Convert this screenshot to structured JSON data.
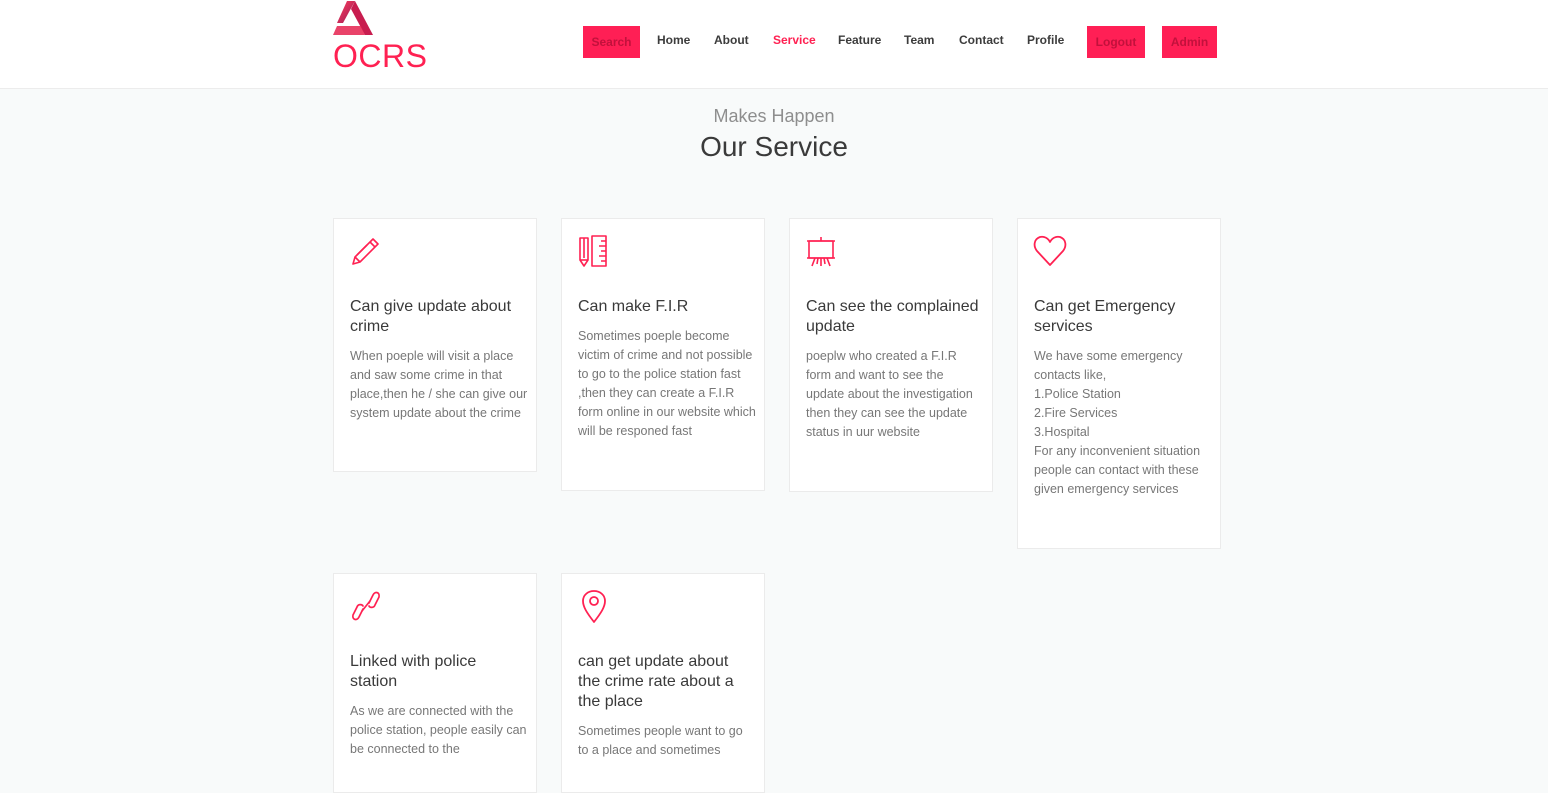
{
  "brand": {
    "name": "OCRS",
    "logo_icon": "triangle-logo-icon"
  },
  "nav": {
    "search_label": "Search",
    "links": [
      "Home",
      "About",
      "Service",
      "Feature",
      "Team",
      "Contact",
      "Profile"
    ],
    "active": "Service",
    "logout_label": "Logout",
    "admin_label": "Admin"
  },
  "section": {
    "subtitle": "Makes Happen",
    "title": "Our Service"
  },
  "services": [
    {
      "icon": "pencil-icon",
      "title": "Can give update about crime",
      "desc": "When poeple will visit a place and saw some crime in that place,then he / she can give our system update about the crime"
    },
    {
      "icon": "ruler-pencil-icon",
      "title": "Can make F.I.R",
      "desc": "Sometimes poeple become victim of crime and not possible to go to the police station fast ,then they can create a F.I.R form online in our website which will be responed fast"
    },
    {
      "icon": "easel-presentation-icon",
      "title": "Can see the complained update",
      "desc": "poeplw who created a F.I.R form and want to see the update about the investigation then they can see the update status in uur website"
    },
    {
      "icon": "heart-icon",
      "title": "Can get Emergency services",
      "desc": "We have some emergency contacts like,\n1.Police Station\n2.Fire Services\n3.Hospital\nFor any inconvenient situation people can contact with these given emergency services"
    },
    {
      "icon": "link-chain-icon",
      "title": "Linked with police station",
      "desc": "As we are connected with the police station, people easily can be connected to the"
    },
    {
      "icon": "map-pin-icon",
      "title": "can get update about the crime rate about a the place",
      "desc": "Sometimes people want to go to a place and sometimes"
    }
  ],
  "colors": {
    "accent": "#ff2152",
    "button_bg": "#ff1f55",
    "text_dark": "#3a3a3a",
    "text_muted": "#777777",
    "page_bg": "#f8fafa"
  }
}
